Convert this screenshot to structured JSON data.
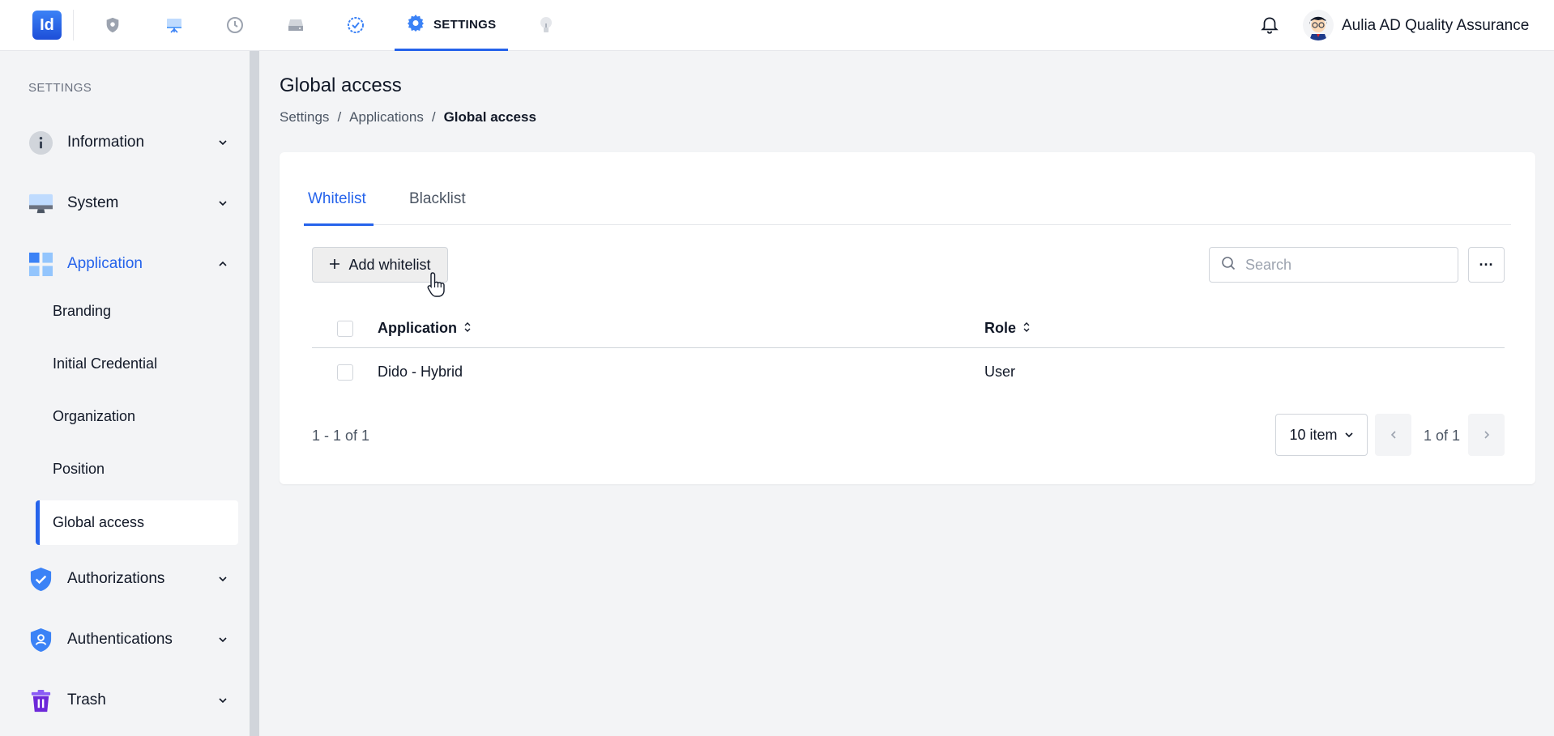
{
  "header": {
    "logo_text": "Id",
    "active_tab_label": "SETTINGS",
    "user_name": "Aulia AD Quality Assurance",
    "nav_icons": [
      "shield-icon",
      "presentation-icon",
      "history-icon",
      "drive-icon",
      "check-circle-icon",
      "gear-icon",
      "lightbulb-icon"
    ],
    "accent": "#2563eb"
  },
  "sidebar": {
    "heading": "SETTINGS",
    "groups": [
      {
        "label": "Information",
        "icon": "info-icon",
        "expanded": false
      },
      {
        "label": "System",
        "icon": "monitor-icon",
        "expanded": false
      },
      {
        "label": "Application",
        "icon": "apps-grid-icon",
        "expanded": true
      },
      {
        "label": "Authorizations",
        "icon": "shield-check-icon",
        "expanded": false
      },
      {
        "label": "Authentications",
        "icon": "shield-user-icon",
        "expanded": false
      },
      {
        "label": "Trash",
        "icon": "trash-icon",
        "expanded": false
      }
    ],
    "subitems": [
      "Branding",
      "Initial Credential",
      "Organization",
      "Position",
      "Global access"
    ],
    "active_subitem": "Global access"
  },
  "main": {
    "title": "Global access",
    "breadcrumb": [
      "Settings",
      "Applications",
      "Global access"
    ],
    "tabs": [
      {
        "label": "Whitelist",
        "active": true
      },
      {
        "label": "Blacklist",
        "active": false
      }
    ],
    "add_button": "Add whitelist",
    "search_placeholder": "Search",
    "more_button": "···",
    "table": {
      "columns": [
        "Application",
        "Role"
      ],
      "rows": [
        {
          "application": "Dido - Hybrid",
          "role": "User"
        }
      ]
    },
    "pagination": {
      "range": "1 - 1 of 1",
      "page_size": "10 item",
      "page_info": "1 of 1"
    }
  }
}
